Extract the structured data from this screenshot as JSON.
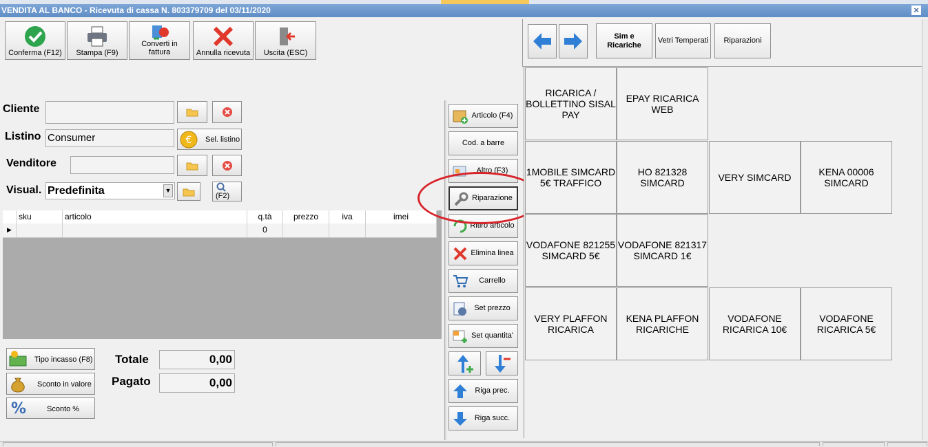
{
  "window": {
    "title": "VENDITA AL BANCO - Ricevuta di cassa N. 803379709 del 03/11/2020",
    "close_glyph": "×"
  },
  "toolbar": {
    "confirm": "Conferma (F12)",
    "print": "Stampa (F9)",
    "convert_line1": "Converti in",
    "convert_line2": "fattura",
    "cancel": "Annulla ricevuta",
    "exit": "Uscita (ESC)"
  },
  "form": {
    "cliente_label": "Cliente",
    "cliente_value": "",
    "listino_label": "Listino",
    "listino_value": "Consumer",
    "sel_listino": "Sel. listino",
    "venditore_label": "Venditore",
    "venditore_value": "",
    "visual_label": "Visual.",
    "visual_value": "Predefinita",
    "f2_label": "(F2)"
  },
  "grid": {
    "columns": [
      "sku",
      "articolo",
      "q.tà",
      "prezzo",
      "iva",
      "imei"
    ],
    "rows": [
      {
        "sku": "",
        "articolo": "",
        "qta": "0",
        "prezzo": "",
        "iva": "",
        "imei": ""
      }
    ]
  },
  "payment": {
    "tipo_incasso": "Tipo incasso (F8)",
    "sconto_valore": "Sconto in valore",
    "sconto_pct": "Sconto %",
    "totale_label": "Totale",
    "totale_value": "0,00",
    "pagato_label": "Pagato",
    "pagato_value": "0,00"
  },
  "actions": {
    "articolo": "Articolo (F4)",
    "cod_barre": "Cod. a barre",
    "altro": "Altro (F3)",
    "riparazione": "Riparazione",
    "ritiro": "Ritiro articolo",
    "elimina": "Elimina linea",
    "carrello": "Carrello",
    "set_prezzo": "Set prezzo",
    "set_quantita": "Set quantita'",
    "riga_prec": "Riga prec.",
    "riga_succ": "Riga succ."
  },
  "categories": {
    "sim_line1": "Sim e",
    "sim_line2": "Ricariche",
    "vetri": "Vetri Temperati",
    "riparazioni": "Riparazioni"
  },
  "tiles": [
    {
      "l1": "RICARICA /",
      "l2": "BOLLETTINO SISAL",
      "l3": "PAY"
    },
    {
      "l1": "EPAY RICARICA",
      "l2": "WEB",
      "l3": ""
    },
    {
      "l1": "1MOBILE SIMCARD",
      "l2": "5€ TRAFFICO",
      "l3": ""
    },
    {
      "l1": "HO 821328",
      "l2": "SIMCARD",
      "l3": ""
    },
    {
      "l1": "VERY SIMCARD",
      "l2": "",
      "l3": ""
    },
    {
      "l1": "KENA 00006",
      "l2": "SIMCARD",
      "l3": ""
    },
    {
      "l1": "VODAFONE 821255",
      "l2": "SIMCARD 5€",
      "l3": ""
    },
    {
      "l1": "VODAFONE 821317",
      "l2": "SIMCARD 1€",
      "l3": ""
    },
    {
      "l1": "VERY PLAFFON",
      "l2": "RICARICA",
      "l3": ""
    },
    {
      "l1": "KENA PLAFFON",
      "l2": "RICARICHE",
      "l3": ""
    },
    {
      "l1": "VODAFONE",
      "l2": "RICARICA 10€",
      "l3": ""
    },
    {
      "l1": "VODAFONE",
      "l2": "RICARICA 5€",
      "l3": ""
    }
  ],
  "colors": {
    "titlebar": "#6b96cc",
    "highlight_circle": "#d8232a",
    "confirm_green": "#2ea44f",
    "cancel_red": "#e0392b"
  }
}
